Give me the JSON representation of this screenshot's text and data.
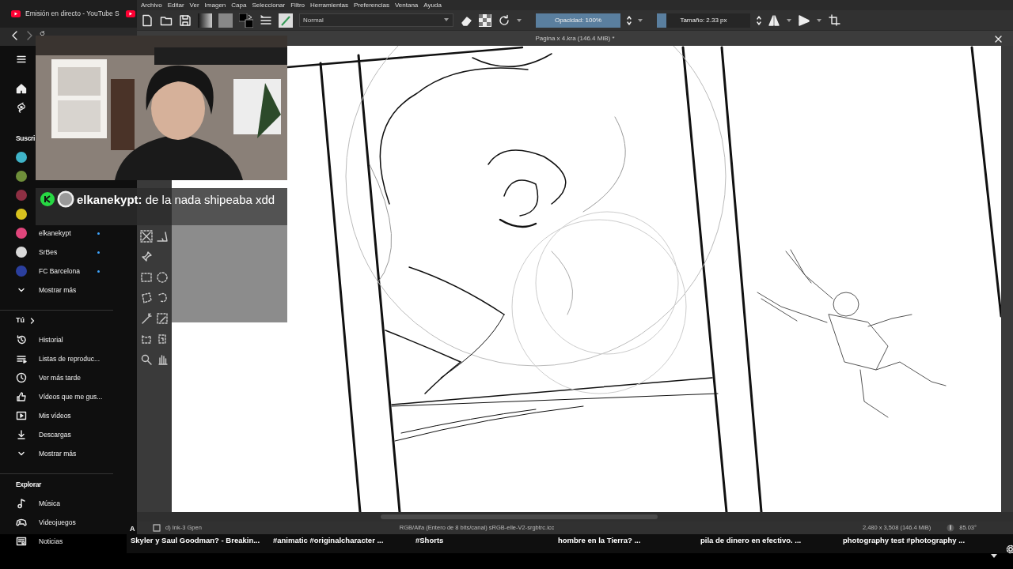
{
  "browser": {
    "tab_title": "Emisión en directo - YouTube S"
  },
  "youtube": {
    "subscriptions_heading": "Suscri",
    "subscriptions": [
      {
        "color": "#3fb4c8"
      },
      {
        "color": "#6f8f3a"
      },
      {
        "color": "#8e2f43"
      },
      {
        "color": "#d8c21e"
      },
      {
        "color": "#e0457b",
        "name": "elkanekypt",
        "live": true
      },
      {
        "color": "#d9d9d9",
        "name": "SrBes",
        "live": true
      },
      {
        "color": "#2b3f9e",
        "name": "FC Barcelona",
        "live": true
      }
    ],
    "subscriptions_more": "Mostrar más",
    "you_heading": "Tú",
    "you_items": [
      {
        "kind": "history",
        "label": "Historial"
      },
      {
        "kind": "playlist",
        "label": "Listas de reproduc..."
      },
      {
        "kind": "clock",
        "label": "Ver más tarde"
      },
      {
        "kind": "like",
        "label": "Vídeos que me gus..."
      },
      {
        "kind": "video",
        "label": "Mis vídeos"
      },
      {
        "kind": "download",
        "label": "Descargas"
      },
      {
        "kind": "more",
        "label": "Mostrar más"
      }
    ],
    "explore_heading": "Explorar",
    "explore_items": [
      {
        "kind": "music",
        "label": "Música"
      },
      {
        "kind": "games",
        "label": "Videojuegos"
      },
      {
        "kind": "news",
        "label": "Noticias"
      }
    ],
    "shelf_letter": "A",
    "videos": [
      {
        "title": "Skyler y Saul Goodman? - Breakin..."
      },
      {
        "title": "#animatic #originalcharacter ..."
      },
      {
        "title": "#Shorts"
      },
      {
        "title": "hombre en la Tierra? ..."
      },
      {
        "title": "pila de dinero en efectivo. ..."
      },
      {
        "title": "photography test #photography ..."
      }
    ]
  },
  "krita": {
    "menu": [
      "Archivo",
      "Editar",
      "Ver",
      "Imagen",
      "Capa",
      "Seleccionar",
      "Filtro",
      "Herramientas",
      "Preferencias",
      "Ventana",
      "Ayuda"
    ],
    "blend_mode": "Normal",
    "opacity": {
      "label": "Opacidad: 100%",
      "level": 1
    },
    "size": {
      "label": "Tamaño: 2.33 px",
      "level": 0.1
    },
    "document_title": "Pagina x 4.kra (146.4 MiB) *",
    "status": {
      "brush": "d) Ink-3 Gpen",
      "color_space": "RGB/Alfa (Entero de 8 bits/canal)  sRGB-elle-V2-srgbtrc.icc",
      "image_size": "2,480 x 3,508 (146.4 MiB)",
      "rotation": "85.03°"
    }
  },
  "chat": {
    "message": "**elkanekypt:** de la nada shipeaba xdd"
  }
}
